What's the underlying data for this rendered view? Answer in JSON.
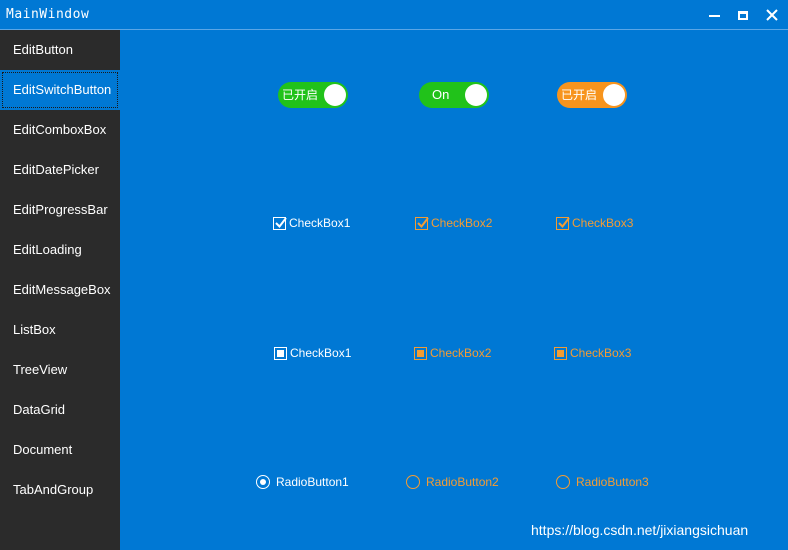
{
  "window": {
    "title": "MainWindow"
  },
  "sidebar": {
    "items": [
      {
        "label": "EditButton"
      },
      {
        "label": "EditSwitchButton"
      },
      {
        "label": "EditComboxBox"
      },
      {
        "label": "EditDatePicker"
      },
      {
        "label": "EditProgressBar"
      },
      {
        "label": "EditLoading"
      },
      {
        "label": "EditMessageBox"
      },
      {
        "label": "ListBox"
      },
      {
        "label": "TreeView"
      },
      {
        "label": "DataGrid"
      },
      {
        "label": "Document"
      },
      {
        "label": "TabAndGroup"
      }
    ],
    "selected": "EditSwitchButton"
  },
  "switches": [
    {
      "label": "已开启",
      "color": "#21c21a",
      "state": "on"
    },
    {
      "label": "On",
      "color": "#21c21a",
      "state": "on"
    },
    {
      "label": "已开启",
      "color": "#f7941d",
      "state": "on"
    }
  ],
  "checkboxes_tick": [
    {
      "label": "CheckBox1",
      "checked": true,
      "color": "#ffffff"
    },
    {
      "label": "CheckBox2",
      "checked": true,
      "color": "#f39c34"
    },
    {
      "label": "CheckBox3",
      "checked": true,
      "color": "#f39c34"
    }
  ],
  "checkboxes_square": [
    {
      "label": "CheckBox1",
      "checked": true,
      "color": "#ffffff"
    },
    {
      "label": "CheckBox2",
      "checked": true,
      "color": "#f39c34"
    },
    {
      "label": "CheckBox3",
      "checked": true,
      "color": "#f39c34"
    }
  ],
  "radios": [
    {
      "label": "RadioButton1",
      "checked": true,
      "color": "#ffffff"
    },
    {
      "label": "RadioButton2",
      "checked": false,
      "color": "#f39c34"
    },
    {
      "label": "RadioButton3",
      "checked": false,
      "color": "#f39c34"
    }
  ],
  "watermark": "https://blog.csdn.net/jixiangsichuan",
  "colors": {
    "accent": "#0078d4",
    "sidebar": "#2b2b2b",
    "green": "#21c21a",
    "orange": "#f7941d"
  }
}
